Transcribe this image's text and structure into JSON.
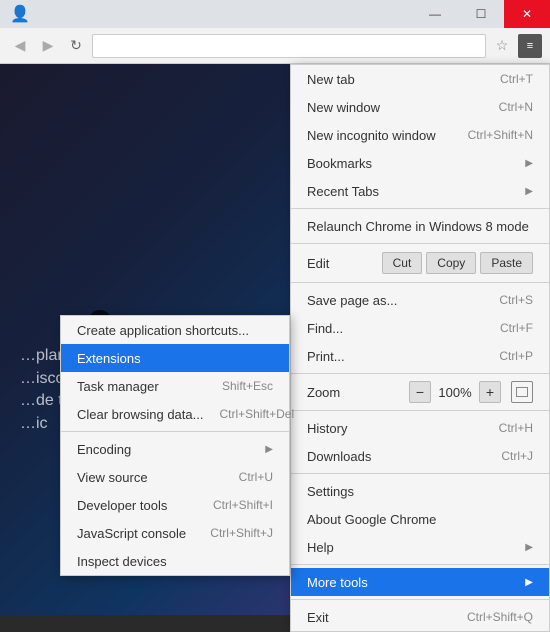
{
  "titlebar": {
    "profile_icon": "👤",
    "minimize_label": "—",
    "maximize_label": "☐",
    "close_label": "✕"
  },
  "toolbar": {
    "star_icon": "☆",
    "menu_icon": "≡"
  },
  "page": {
    "close_circle": "✕",
    "content_lines": [
      "…plant,",
      "…iscover for",
      "…de to",
      "…ic"
    ]
  },
  "chrome_menu": {
    "items": [
      {
        "label": "New tab",
        "shortcut": "Ctrl+T",
        "arrow": false,
        "type": "item"
      },
      {
        "label": "New window",
        "shortcut": "Ctrl+N",
        "arrow": false,
        "type": "item"
      },
      {
        "label": "New incognito window",
        "shortcut": "Ctrl+Shift+N",
        "arrow": false,
        "type": "item"
      },
      {
        "label": "Bookmarks",
        "shortcut": "",
        "arrow": true,
        "type": "item"
      },
      {
        "label": "Recent Tabs",
        "shortcut": "",
        "arrow": true,
        "type": "item"
      },
      {
        "type": "separator"
      },
      {
        "label": "Relaunch Chrome in Windows 8 mode",
        "shortcut": "",
        "arrow": false,
        "type": "item"
      },
      {
        "type": "separator"
      },
      {
        "type": "edit_row"
      },
      {
        "type": "separator"
      },
      {
        "label": "Save page as...",
        "shortcut": "Ctrl+S",
        "arrow": false,
        "type": "item"
      },
      {
        "label": "Find...",
        "shortcut": "Ctrl+F",
        "arrow": false,
        "type": "item"
      },
      {
        "label": "Print...",
        "shortcut": "Ctrl+P",
        "arrow": false,
        "type": "item"
      },
      {
        "type": "separator"
      },
      {
        "type": "zoom_row"
      },
      {
        "type": "separator"
      },
      {
        "label": "History",
        "shortcut": "Ctrl+H",
        "arrow": false,
        "type": "item"
      },
      {
        "label": "Downloads",
        "shortcut": "Ctrl+J",
        "arrow": false,
        "type": "item"
      },
      {
        "type": "separator"
      },
      {
        "label": "Settings",
        "shortcut": "",
        "arrow": false,
        "type": "item"
      },
      {
        "label": "About Google Chrome",
        "shortcut": "",
        "arrow": false,
        "type": "item"
      },
      {
        "label": "Help",
        "shortcut": "",
        "arrow": true,
        "type": "item"
      },
      {
        "type": "separator"
      },
      {
        "label": "More tools",
        "shortcut": "",
        "arrow": true,
        "type": "item",
        "highlighted": true
      },
      {
        "type": "separator"
      },
      {
        "label": "Exit",
        "shortcut": "Ctrl+Shift+Q",
        "arrow": false,
        "type": "item"
      }
    ],
    "edit_row": {
      "label": "Edit",
      "buttons": [
        "Cut",
        "Copy",
        "Paste"
      ]
    },
    "zoom_row": {
      "label": "Zoom",
      "minus": "−",
      "value": "100%",
      "plus": "+"
    }
  },
  "submenu": {
    "items": [
      {
        "label": "Create application shortcuts...",
        "shortcut": "",
        "arrow": false
      },
      {
        "label": "Extensions",
        "shortcut": "",
        "arrow": false,
        "selected": true
      },
      {
        "label": "Task manager",
        "shortcut": "Shift+Esc",
        "arrow": false
      },
      {
        "label": "Clear browsing data...",
        "shortcut": "Ctrl+Shift+Del",
        "arrow": false
      },
      {
        "type": "separator"
      },
      {
        "label": "Encoding",
        "shortcut": "",
        "arrow": true
      },
      {
        "label": "View source",
        "shortcut": "Ctrl+U",
        "arrow": false
      },
      {
        "label": "Developer tools",
        "shortcut": "Ctrl+Shift+I",
        "arrow": false
      },
      {
        "label": "JavaScript console",
        "shortcut": "Ctrl+Shift+J",
        "arrow": false
      },
      {
        "label": "Inspect devices",
        "shortcut": "",
        "arrow": false
      }
    ]
  }
}
